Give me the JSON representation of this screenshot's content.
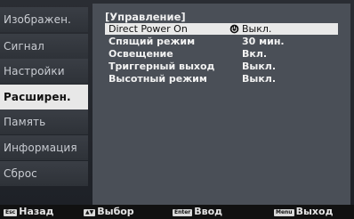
{
  "menu": {
    "items": [
      {
        "label": "Изображен."
      },
      {
        "label": "Сигнал"
      },
      {
        "label": "Настройки"
      },
      {
        "label": "Расширен."
      },
      {
        "label": "Память"
      },
      {
        "label": "Информация"
      },
      {
        "label": "Сброс"
      }
    ],
    "active_index": 3
  },
  "panel": {
    "title": "[Управление]",
    "rows": [
      {
        "label": "Direct Power On",
        "value": "Выкл."
      },
      {
        "label": "Спящий режим",
        "value": "30 мин."
      },
      {
        "label": "Освещение",
        "value": "Вкл."
      },
      {
        "label": "Триггерный выход",
        "value": "Выкл."
      },
      {
        "label": "Высотный режим",
        "value": "Выкл."
      }
    ]
  },
  "bottom_bar": {
    "back_key": "Esc",
    "back_label": "Назад",
    "select_key": "▲▼",
    "select_label": "Выбор",
    "enter_key": "Enter",
    "enter_label": "Ввод",
    "exit_key": "Menu",
    "exit_label": "Выход"
  },
  "colors": {
    "selected_bg": "#e9e9e9",
    "panel_bg": "#4a4f57",
    "menu_bg": "#3a3e45"
  }
}
